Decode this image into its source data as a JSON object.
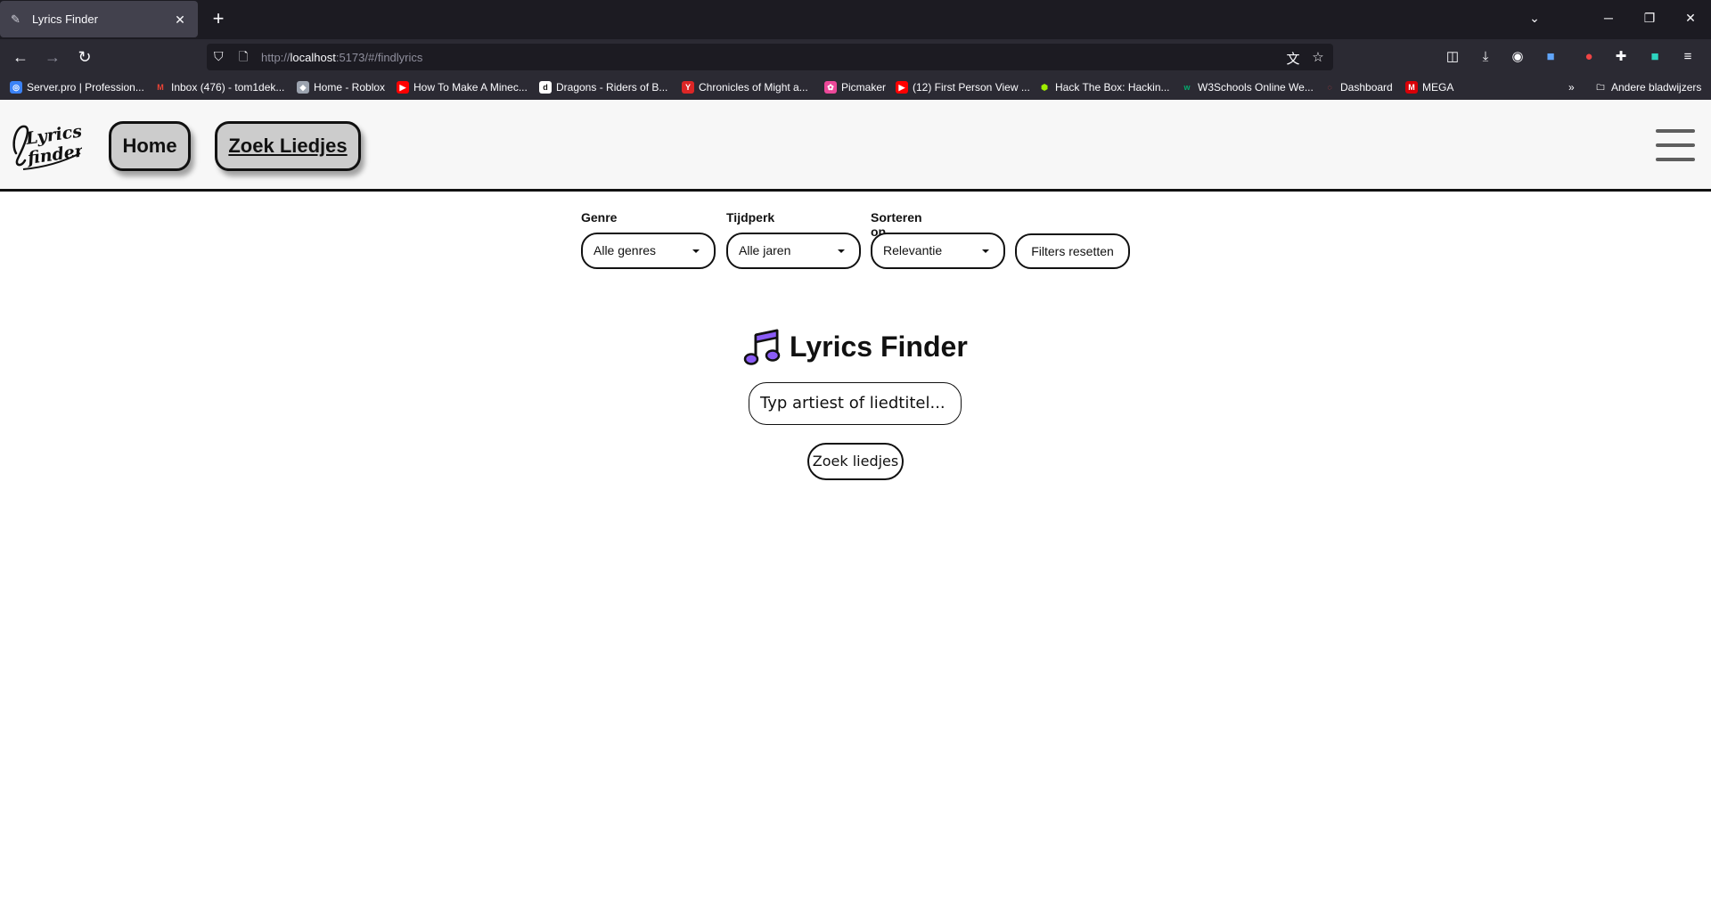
{
  "browser": {
    "tab_title": "Lyrics Finder",
    "url_prefix": "http://",
    "url_host": "localhost",
    "url_rest": ":5173/#/findlyrics",
    "bookmarks": [
      {
        "label": "Server.pro | Profession...",
        "color": "#3b82f6"
      },
      {
        "label": "Inbox (476) - tom1dek...",
        "color": "#ea4335"
      },
      {
        "label": "Home - Roblox",
        "color": "#9ca3af"
      },
      {
        "label": "How To Make A Minec...",
        "color": "#ff0000"
      },
      {
        "label": "Dragons - Riders of B...",
        "color": "#ffffff"
      },
      {
        "label": "Chronicles of Might a...",
        "color": "#dc2626"
      },
      {
        "label": "Picmaker",
        "color": "#ec4899"
      },
      {
        "label": "(12) First Person View ...",
        "color": "#ff0000"
      },
      {
        "label": "Hack The Box: Hackin...",
        "color": "#9fef00"
      },
      {
        "label": "W3Schools Online We...",
        "color": "#04aa6d"
      },
      {
        "label": "Dashboard",
        "color": "#ef4444"
      },
      {
        "label": "MEGA",
        "color": "#d90007"
      }
    ],
    "other_bookmarks": "Andere bladwijzers"
  },
  "header": {
    "nav_home": "Home",
    "nav_search": "Zoek Liedjes"
  },
  "filters": {
    "genre_label": "Genre",
    "genre_value": "Alle genres",
    "era_label": "Tijdperk",
    "era_value": "Alle jaren",
    "sort_label": "Sorteren op",
    "sort_value": "Relevantie",
    "reset_label": "Filters resetten"
  },
  "main": {
    "title": "Lyrics Finder",
    "search_placeholder": "Typ artiest of liedtitel...",
    "search_button": "Zoek liedjes"
  },
  "colors": {
    "accent": "#8b5cf6",
    "nav_pill": "#cccccc",
    "header_bg": "#f7f7f7"
  }
}
